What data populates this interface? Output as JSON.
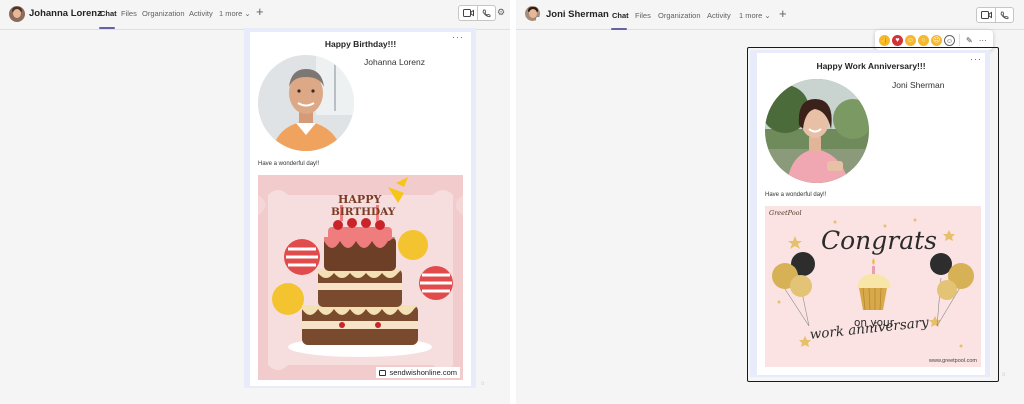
{
  "left": {
    "contact_name": "Johanna Lorenz",
    "tabs": [
      {
        "label": "Chat"
      },
      {
        "label": "Files"
      },
      {
        "label": "Organization"
      },
      {
        "label": "Activity"
      },
      {
        "label": "1 more ⌄"
      }
    ],
    "add_tab_icon": "plus-icon",
    "card": {
      "title": "Happy Birthday!!!",
      "person_name": "Johanna Lorenz",
      "message": "Have a wonderful day!!",
      "image": {
        "headline_1": "HAPPY",
        "headline_2": "BIRTHDAY",
        "watermark": "sendwishonline.com"
      }
    }
  },
  "right": {
    "contact_name": "Joni Sherman",
    "tabs": [
      {
        "label": "Chat"
      },
      {
        "label": "Files"
      },
      {
        "label": "Organization"
      },
      {
        "label": "Activity"
      },
      {
        "label": "1 more ⌄"
      }
    ],
    "add_tab_icon": "plus-icon",
    "card": {
      "title": "Happy Work Anniversary!!!",
      "person_name": "Joni Sherman",
      "message": "Have a wonderful day!!",
      "image": {
        "brand": "GreetPool",
        "headline": "Congrats",
        "line_2": "on your",
        "line_3": "work anniversary",
        "watermark": "www.greetpool.com"
      }
    },
    "reactions": [
      "like-reaction",
      "heart-reaction",
      "laugh-reaction",
      "surprised-reaction",
      "sad-reaction",
      "emoji-picker-icon"
    ]
  },
  "colors": {
    "accent": "#6264a7",
    "message_bubble": "#e8ebfa",
    "card_bg": "#ffffff",
    "birthday_bg": "#f5d6d6",
    "anniversary_bg": "#fbe3e3"
  }
}
